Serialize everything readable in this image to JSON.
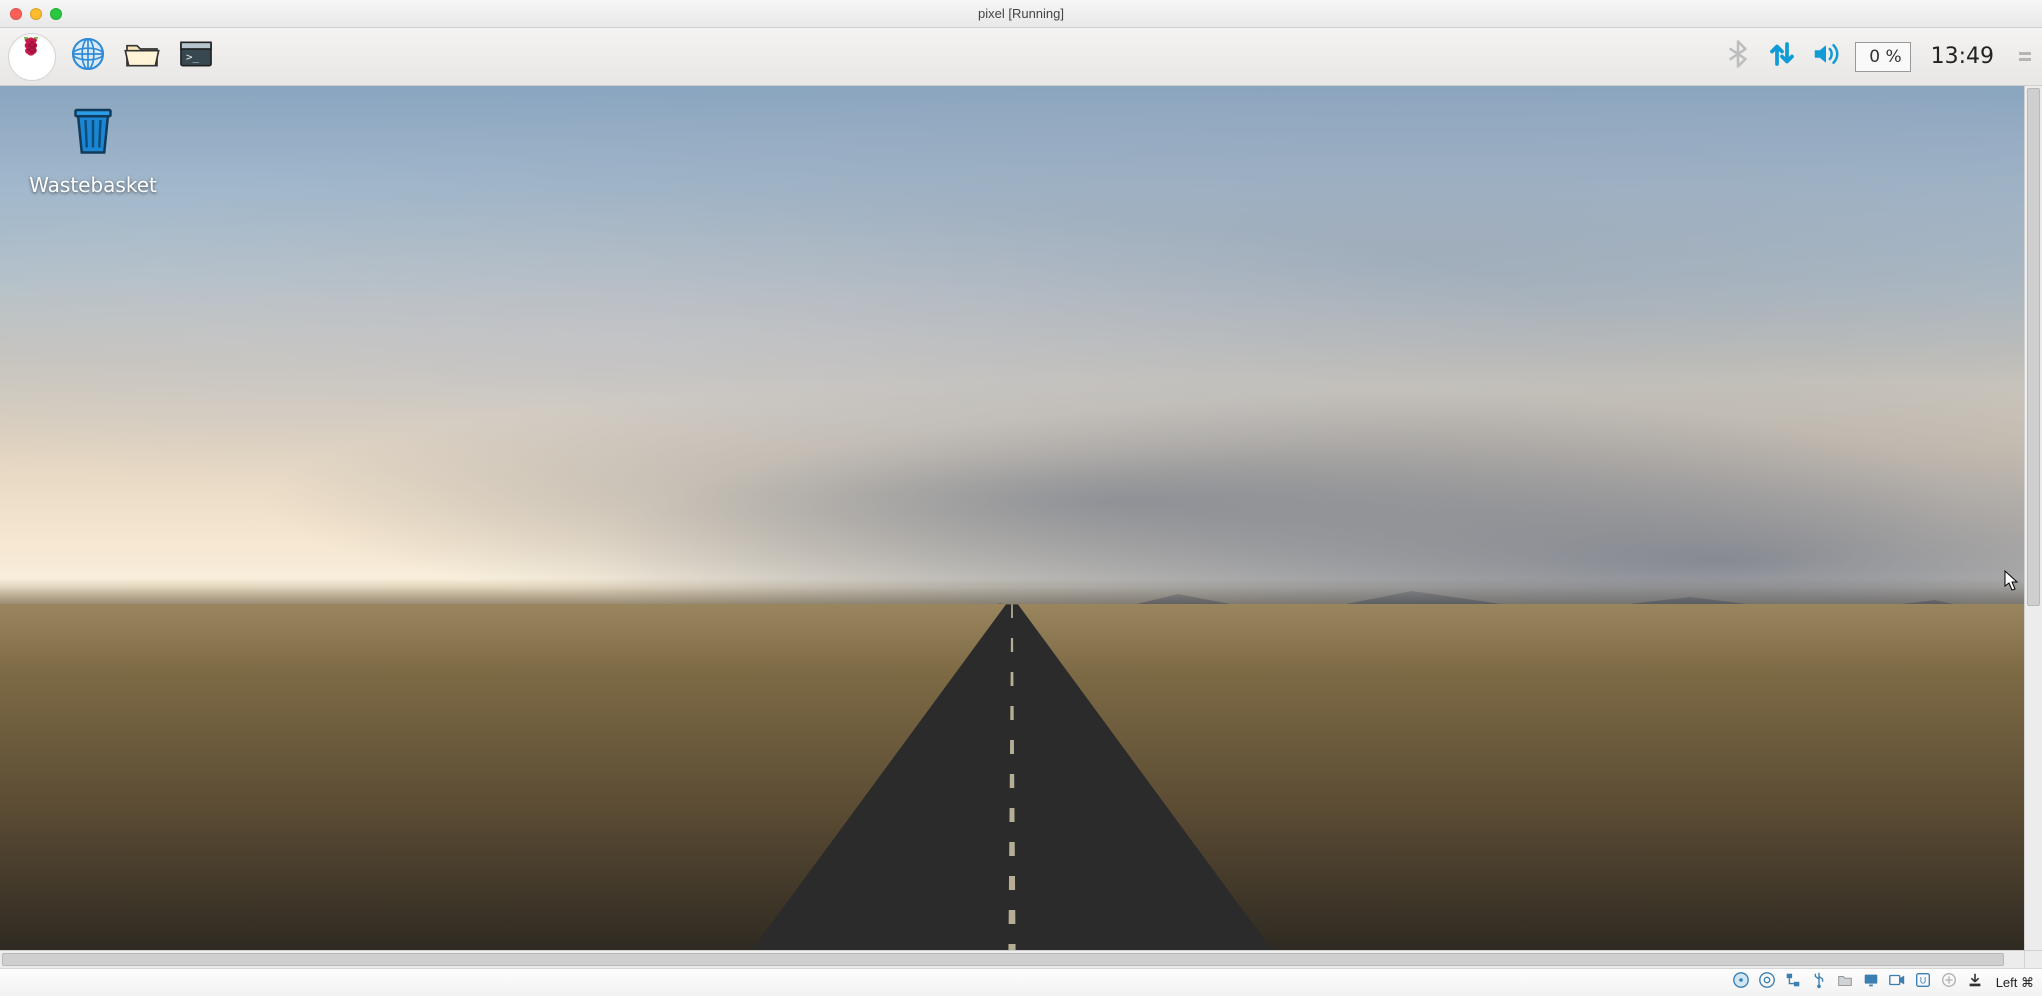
{
  "window": {
    "title": "pixel [Running]"
  },
  "panel": {
    "launchers": {
      "menu": "menu",
      "browser": "web-browser",
      "files": "file-manager",
      "terminal": "terminal"
    },
    "tray": {
      "bluetooth": "bluetooth",
      "network": "network",
      "volume": "volume",
      "cpu_text": "0 %",
      "clock": "13:49"
    }
  },
  "desktop": {
    "wastebasket_label": "Wastebasket"
  },
  "vbox": {
    "hostkey": "Left ⌘"
  }
}
